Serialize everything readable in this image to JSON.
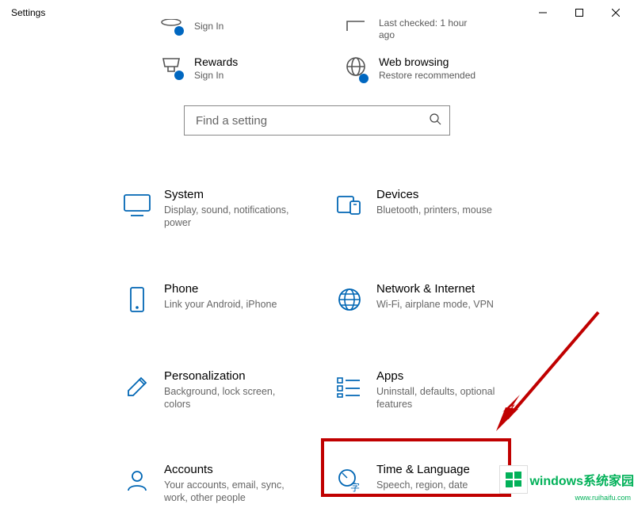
{
  "window": {
    "title": "Settings"
  },
  "search": {
    "placeholder": "Find a setting"
  },
  "topStrip": {
    "signin": {
      "title": "",
      "sub": "Sign In"
    },
    "rewards": {
      "title": "Rewards",
      "sub": "Sign In"
    },
    "update": {
      "title": "",
      "sub": "Last checked: 1 hour ago"
    },
    "web": {
      "title": "Web browsing",
      "sub": "Restore recommended"
    }
  },
  "tiles": {
    "system": {
      "title": "System",
      "sub": "Display, sound, notifications, power"
    },
    "devices": {
      "title": "Devices",
      "sub": "Bluetooth, printers, mouse"
    },
    "phone": {
      "title": "Phone",
      "sub": "Link your Android, iPhone"
    },
    "network": {
      "title": "Network & Internet",
      "sub": "Wi-Fi, airplane mode, VPN"
    },
    "personal": {
      "title": "Personalization",
      "sub": "Background, lock screen, colors"
    },
    "apps": {
      "title": "Apps",
      "sub": "Uninstall, defaults, optional features"
    },
    "accounts": {
      "title": "Accounts",
      "sub": "Your accounts, email, sync, work, other people"
    },
    "time": {
      "title": "Time & Language",
      "sub": "Speech, region, date"
    }
  },
  "watermark": {
    "text": "windows系统家园",
    "url": "www.ruihaifu.com"
  }
}
